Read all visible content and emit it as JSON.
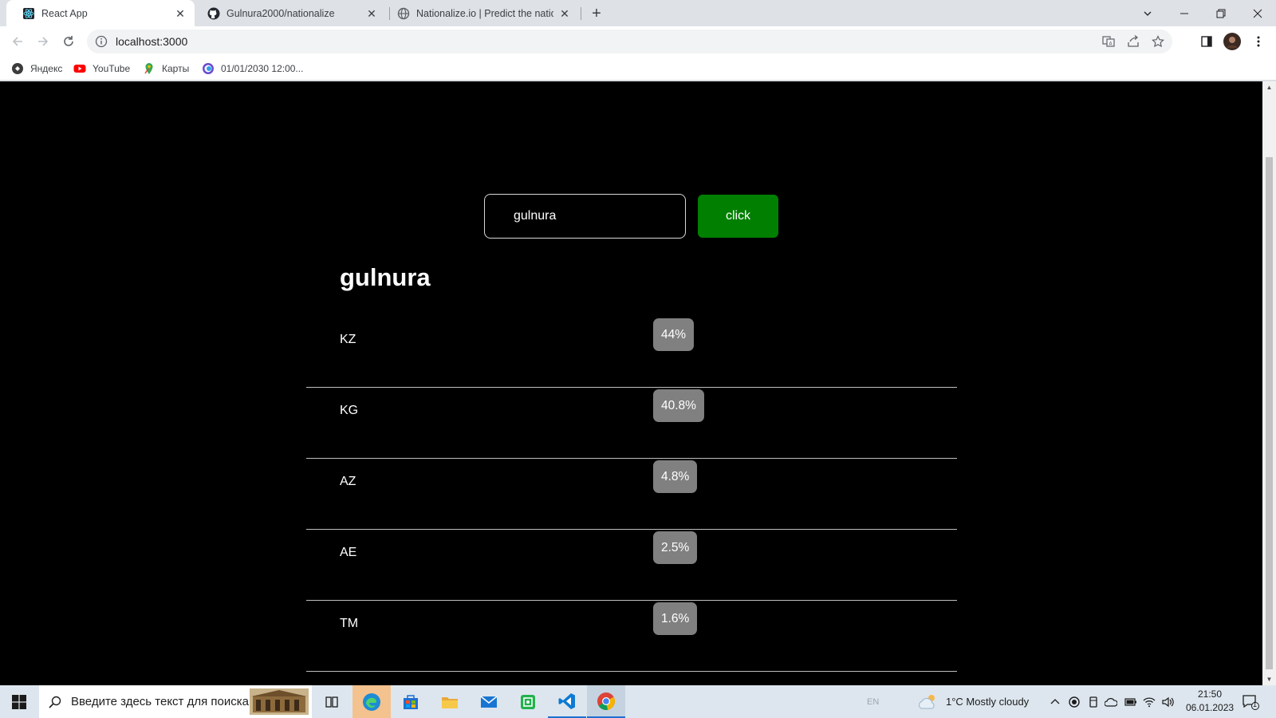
{
  "browser": {
    "tabs": [
      {
        "title": "React App",
        "active": true,
        "icon": "react-icon"
      },
      {
        "title": "Gulnura2000/nationalize",
        "active": false,
        "icon": "github-icon"
      },
      {
        "title": "Nationalize.io | Predict the nation",
        "active": false,
        "icon": "globe-icon"
      }
    ],
    "url": "localhost:3000",
    "bookmarks": [
      {
        "label": "Яндекс",
        "icon": "yandex-icon"
      },
      {
        "label": "YouTube",
        "icon": "youtube-icon"
      },
      {
        "label": "Карты",
        "icon": "maps-icon"
      },
      {
        "label": "01/01/2030 12:00...",
        "icon": "edge-icon"
      }
    ]
  },
  "app": {
    "input_value": "gulnura",
    "button_label": "click",
    "result_name": "gulnura",
    "results": [
      {
        "country": "KZ",
        "probability": "44%"
      },
      {
        "country": "KG",
        "probability": "40.8%"
      },
      {
        "country": "AZ",
        "probability": "4.8%"
      },
      {
        "country": "AE",
        "probability": "2.5%"
      },
      {
        "country": "TM",
        "probability": "1.6%"
      }
    ]
  },
  "taskbar": {
    "search_placeholder": "Введите здесь текст для поиска",
    "lang": "EN",
    "weather": "1°C  Mostly cloudy",
    "time": "21:50",
    "date": "06.01.2023",
    "notification_count": "1"
  },
  "colors": {
    "page_bg": "#000000",
    "button_bg": "#007f00",
    "badge_bg": "#808080",
    "divider": "#bfbfbf"
  }
}
